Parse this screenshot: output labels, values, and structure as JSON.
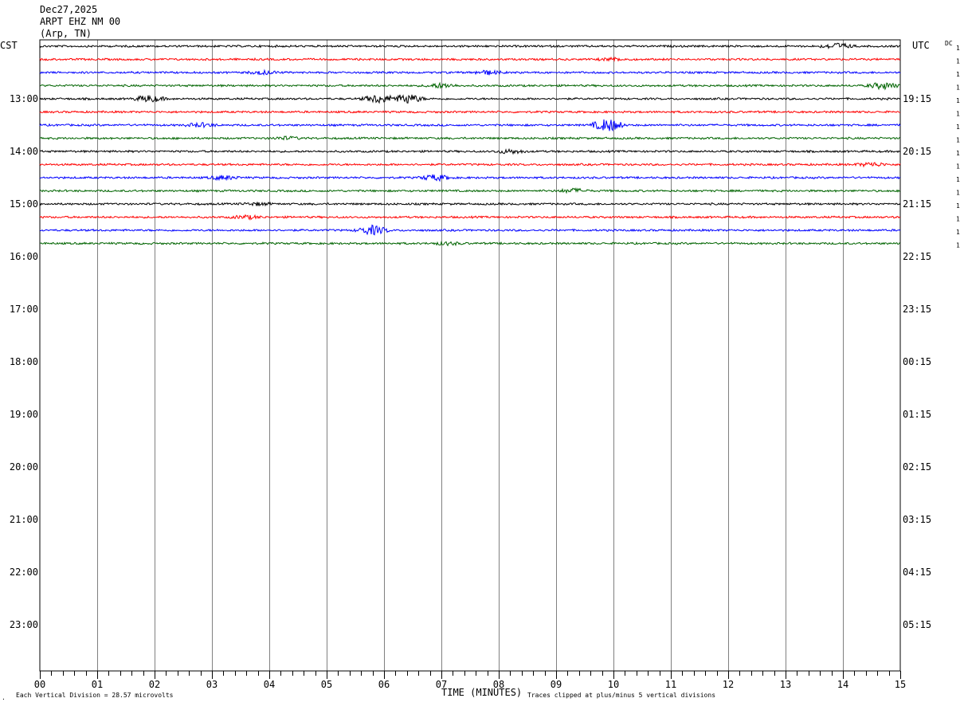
{
  "header": {
    "date": "Dec27,2025",
    "station": "ARPT EHZ NM 00",
    "location": "(Arp, TN)"
  },
  "left_zone": "CST",
  "right_zone": "UTC",
  "dc_label": "DC",
  "footer": {
    "scale_note": "Each Vertical Division =   28.57 microvolts",
    "axis_title": "TIME (MINUTES)",
    "clip_note": "Traces clipped at plus/minus 5 vertical divisions",
    "corner_mark": "."
  },
  "colors": {
    "trace_cycle": [
      "#000000",
      "#ff0000",
      "#0000ff",
      "#006400"
    ],
    "grid": "#808080",
    "frame": "#000000"
  },
  "chart_data": {
    "type": "line",
    "title": "",
    "xlabel": "TIME (MINUTES)",
    "ylabel": "",
    "xlim": [
      0,
      15
    ],
    "x_ticks": [
      "00",
      "01",
      "02",
      "03",
      "04",
      "05",
      "06",
      "07",
      "08",
      "09",
      "10",
      "11",
      "12",
      "13",
      "14",
      "15"
    ],
    "minor_ticks_per_minute": 4,
    "grid": true,
    "left_hour_labels": [
      "13:00",
      "14:00",
      "15:00",
      "16:00",
      "17:00",
      "18:00",
      "19:00",
      "20:00",
      "21:00",
      "22:00",
      "23:00"
    ],
    "right_hour_labels": [
      "19:15",
      "20:15",
      "21:15",
      "22:15",
      "23:15",
      "00:15",
      "01:15",
      "02:15",
      "03:15",
      "04:15",
      "05:15"
    ],
    "traces_per_hour": 4,
    "total_trace_slots": 48,
    "first_label_slot": 4,
    "recorded_traces": 16,
    "trace_dc_labels": [
      "1",
      "1",
      "1",
      "1",
      "1",
      "1",
      "1",
      "1",
      "1",
      "1",
      "1",
      "1",
      "1",
      "1",
      "1",
      "1"
    ],
    "events": [
      {
        "trace": 0,
        "minute": 13.9,
        "amplitude": 0.9
      },
      {
        "trace": 1,
        "minute": 10.0,
        "amplitude": 0.4
      },
      {
        "trace": 2,
        "minute": 7.8,
        "amplitude": 0.6
      },
      {
        "trace": 2,
        "minute": 3.9,
        "amplitude": 0.5
      },
      {
        "trace": 3,
        "minute": 7.0,
        "amplitude": 0.7
      },
      {
        "trace": 3,
        "minute": 14.7,
        "amplitude": 1.0
      },
      {
        "trace": 4,
        "minute": 1.9,
        "amplitude": 1.0
      },
      {
        "trace": 4,
        "minute": 5.9,
        "amplitude": 1.3
      },
      {
        "trace": 4,
        "minute": 6.4,
        "amplitude": 1.5
      },
      {
        "trace": 6,
        "minute": 9.9,
        "amplitude": 2.0
      },
      {
        "trace": 6,
        "minute": 2.8,
        "amplitude": 0.6
      },
      {
        "trace": 7,
        "minute": 4.3,
        "amplitude": 0.4
      },
      {
        "trace": 8,
        "minute": 8.2,
        "amplitude": 0.6
      },
      {
        "trace": 9,
        "minute": 14.5,
        "amplitude": 0.6
      },
      {
        "trace": 10,
        "minute": 6.9,
        "amplitude": 0.9
      },
      {
        "trace": 10,
        "minute": 3.2,
        "amplitude": 0.6
      },
      {
        "trace": 11,
        "minute": 9.3,
        "amplitude": 0.6
      },
      {
        "trace": 12,
        "minute": 3.8,
        "amplitude": 0.4
      },
      {
        "trace": 13,
        "minute": 3.6,
        "amplitude": 0.5
      },
      {
        "trace": 14,
        "minute": 5.8,
        "amplitude": 1.4
      },
      {
        "trace": 15,
        "minute": 7.1,
        "amplitude": 0.4
      }
    ]
  }
}
